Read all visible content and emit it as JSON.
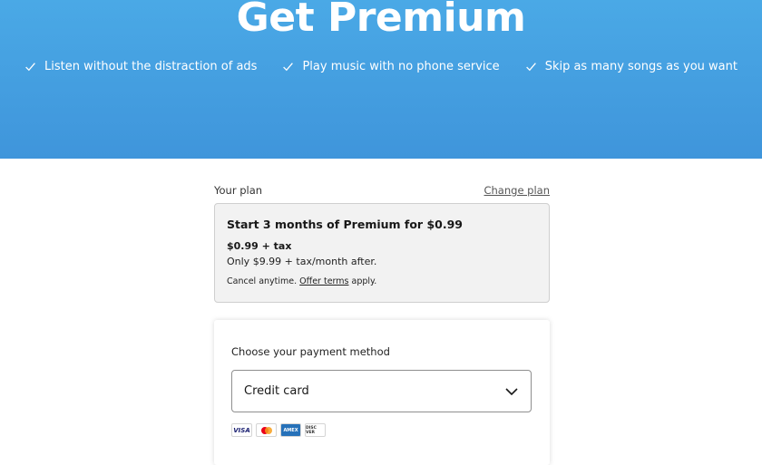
{
  "hero": {
    "title": "Get Premium",
    "background_color": "#3f95db",
    "benefits": [
      {
        "icon": "check-icon",
        "text": "Listen without the distraction of ads"
      },
      {
        "icon": "check-icon",
        "text": "Play music with no phone service"
      },
      {
        "icon": "check-icon",
        "text": "Skip as many songs as you want"
      }
    ]
  },
  "plan": {
    "label": "Your plan",
    "change_link": "Change plan",
    "title": "Start 3 months of Premium for $0.99",
    "price": "$0.99 + tax",
    "after": "Only $9.99 + tax/month after.",
    "cancel_prefix": "Cancel anytime. ",
    "offer_link": "Offer terms",
    "cancel_suffix": " apply."
  },
  "payment": {
    "label": "Choose your payment method",
    "selected_method": "Credit card",
    "card_logos": [
      {
        "icon": "visa-logo",
        "text": "VISA"
      },
      {
        "icon": "mastercard-logo",
        "text": ""
      },
      {
        "icon": "amex-logo",
        "text": "AMEX"
      },
      {
        "icon": "discover-logo",
        "text": "DISC VER"
      }
    ]
  }
}
